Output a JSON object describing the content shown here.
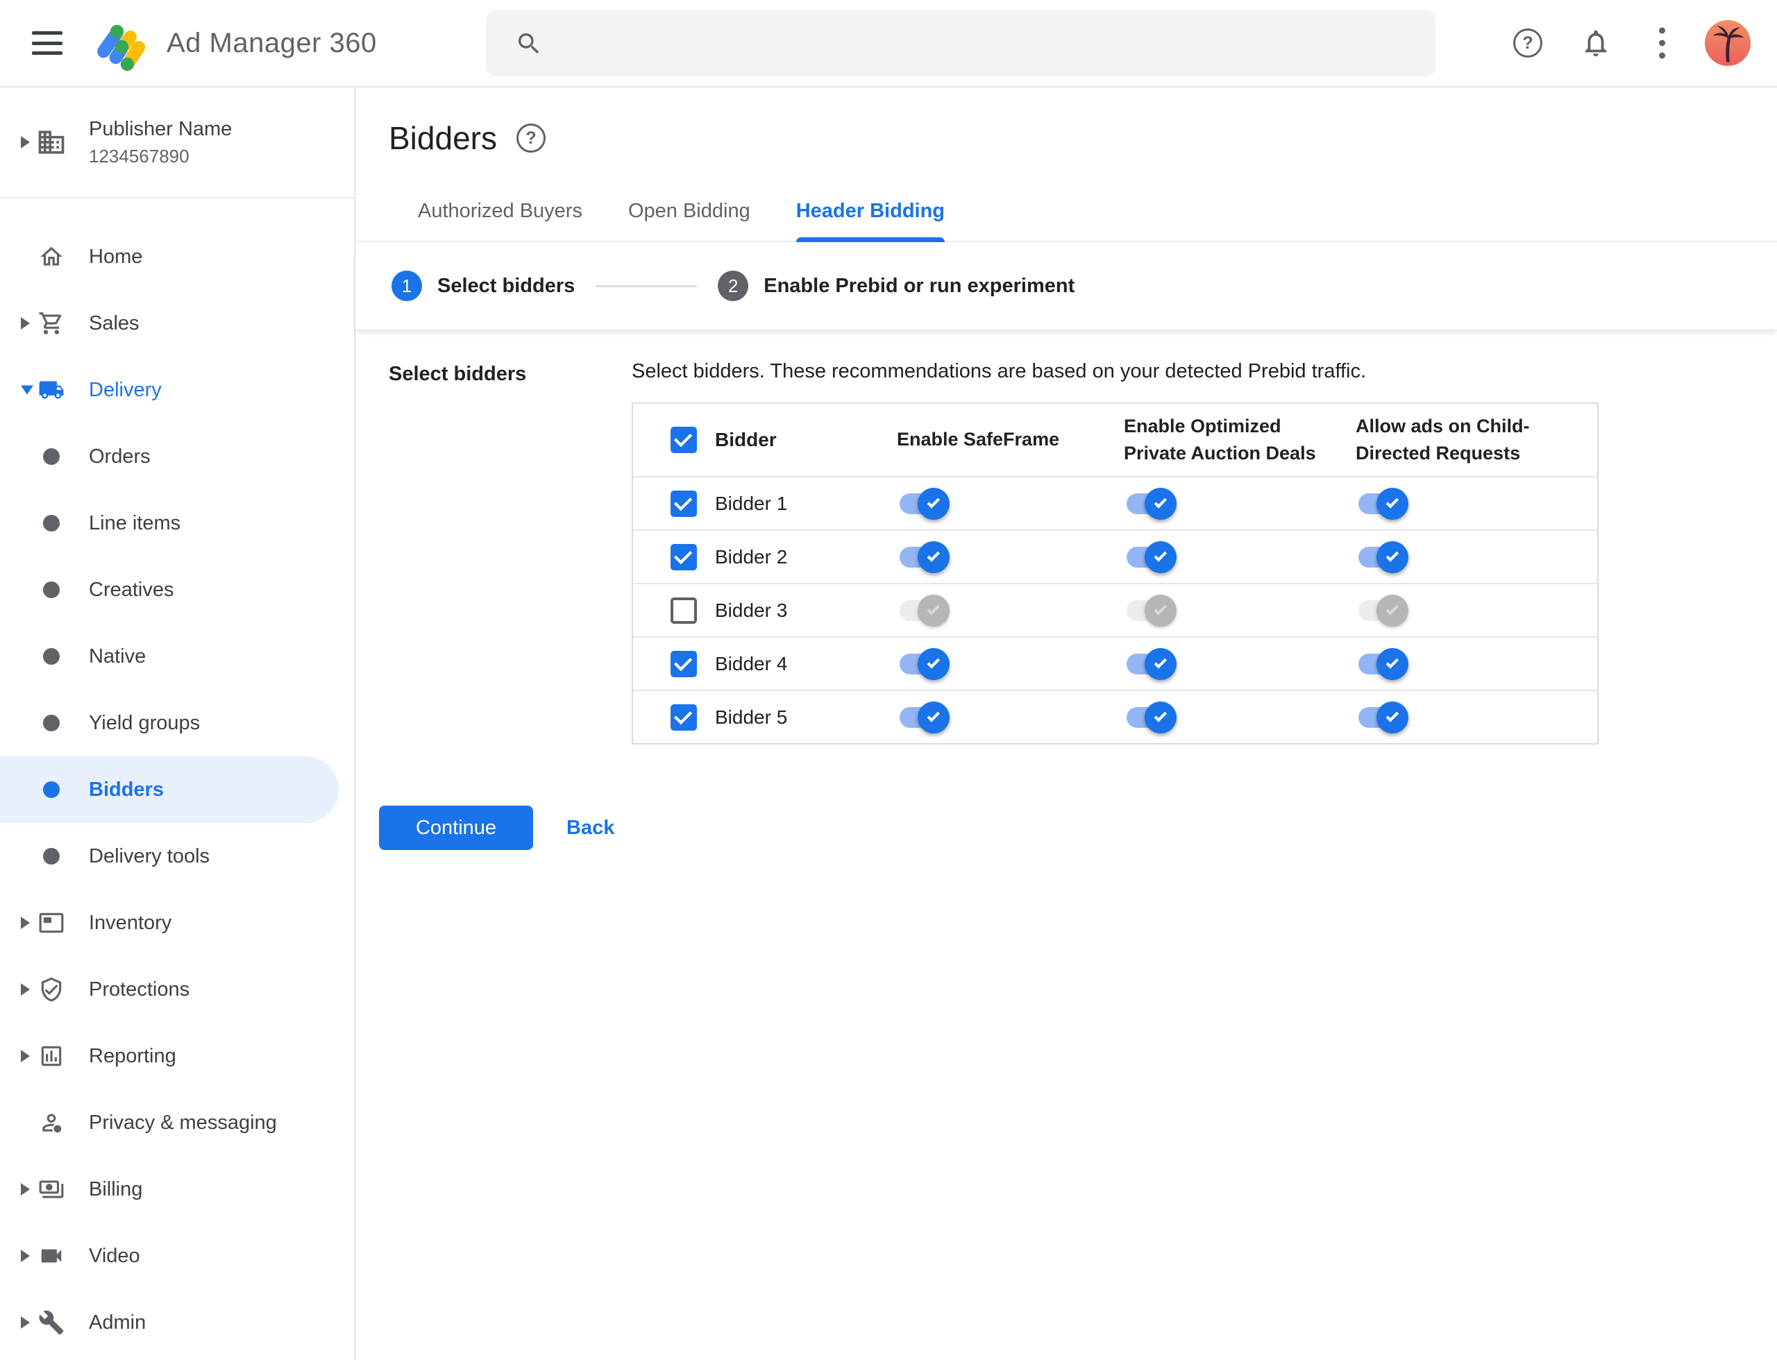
{
  "colors": {
    "accent_blue": "#1a73e8",
    "toggle_track_on": "#94b5f4",
    "toggle_off_track": "#ececec",
    "toggle_off_thumb": "#b6b6b6",
    "active_item_bg": "#e8f0fe",
    "text_primary": "#202124",
    "text_secondary": "#5f6368",
    "logo_blue": "#4285f4",
    "logo_yellow": "#fbbc04",
    "logo_green": "#34a853"
  },
  "topbar": {
    "app_title": "Ad Manager 360",
    "search": {
      "value": "",
      "placeholder": ""
    },
    "icons": [
      "menu-icon",
      "ad-manager-logo",
      "search-icon",
      "help-icon",
      "notifications-icon",
      "more-options-icon",
      "avatar"
    ]
  },
  "sidebar": {
    "publisher": {
      "name": "Publisher Name",
      "id": "1234567890",
      "icon": "building-icon",
      "arrow": "right"
    },
    "items": [
      {
        "label": "Home",
        "icon": "home",
        "arrow": "none",
        "active": false,
        "blue": false
      },
      {
        "label": "Sales",
        "icon": "cart",
        "arrow": "right",
        "active": false,
        "blue": false
      },
      {
        "label": "Delivery",
        "icon": "truck",
        "arrow": "down",
        "active": false,
        "blue": true
      },
      {
        "label": "Orders",
        "icon": "bullet",
        "arrow": "none",
        "active": false,
        "blue": false
      },
      {
        "label": "Line items",
        "icon": "bullet",
        "arrow": "none",
        "active": false,
        "blue": false
      },
      {
        "label": "Creatives",
        "icon": "bullet",
        "arrow": "none",
        "active": false,
        "blue": false
      },
      {
        "label": "Native",
        "icon": "bullet",
        "arrow": "none",
        "active": false,
        "blue": false
      },
      {
        "label": "Yield groups",
        "icon": "bullet",
        "arrow": "none",
        "active": false,
        "blue": false
      },
      {
        "label": "Bidders",
        "icon": "bullet",
        "arrow": "none",
        "active": true,
        "blue": false
      },
      {
        "label": "Delivery tools",
        "icon": "bullet",
        "arrow": "none",
        "active": false,
        "blue": false
      },
      {
        "label": "Inventory",
        "icon": "inventory",
        "arrow": "right",
        "active": false,
        "blue": false
      },
      {
        "label": "Protections",
        "icon": "shield",
        "arrow": "right",
        "active": false,
        "blue": false
      },
      {
        "label": "Reporting",
        "icon": "report",
        "arrow": "right",
        "active": false,
        "blue": false
      },
      {
        "label": "Privacy & messaging",
        "icon": "privacy",
        "arrow": "none",
        "active": false,
        "blue": false
      },
      {
        "label": "Billing",
        "icon": "billing",
        "arrow": "right",
        "active": false,
        "blue": false
      },
      {
        "label": "Video",
        "icon": "video",
        "arrow": "right",
        "active": false,
        "blue": false
      },
      {
        "label": "Admin",
        "icon": "admin",
        "arrow": "right",
        "active": false,
        "blue": false
      }
    ]
  },
  "main": {
    "title": "Bidders",
    "title_help_icon": "help-icon",
    "tabs": [
      {
        "label": "Authorized Buyers",
        "active": false
      },
      {
        "label": "Open Bidding",
        "active": false
      },
      {
        "label": "Header Bidding",
        "active": true
      }
    ],
    "stepper": [
      {
        "num": "1",
        "label": "Select bidders",
        "state": "current"
      },
      {
        "num": "2",
        "label": "Enable Prebid or run experiment",
        "state": "upcoming"
      }
    ],
    "section_label": "Select bidders",
    "description": "Select bidders. These recommendations are based on your detected Prebid traffic.",
    "table": {
      "select_all_checked": true,
      "columns": [
        "Bidder",
        "Enable SafeFrame",
        "Enable Optimized Private Auction Deals",
        "Allow ads on Child-Directed Requests"
      ],
      "rows": [
        {
          "name": "Bidder 1",
          "checked": true,
          "safeframe": true,
          "optimized": true,
          "child_directed": true
        },
        {
          "name": "Bidder 2",
          "checked": true,
          "safeframe": true,
          "optimized": true,
          "child_directed": true
        },
        {
          "name": "Bidder 3",
          "checked": false,
          "safeframe": false,
          "optimized": false,
          "child_directed": false
        },
        {
          "name": "Bidder 4",
          "checked": true,
          "safeframe": true,
          "optimized": true,
          "child_directed": true
        },
        {
          "name": "Bidder 5",
          "checked": true,
          "safeframe": true,
          "optimized": true,
          "child_directed": true
        }
      ]
    },
    "buttons": {
      "continue": "Continue",
      "back": "Back"
    }
  }
}
